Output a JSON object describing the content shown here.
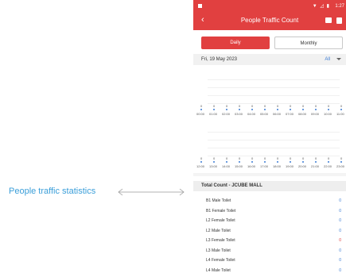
{
  "annotation": {
    "label": "People traffic statistics"
  },
  "status_bar": {
    "time": "1:27",
    "icons": "▼ ◿ ▮"
  },
  "app_bar": {
    "back": "‹",
    "title": "People Traffic Count"
  },
  "tabs": {
    "daily": "Daily",
    "monthly": "Monthly"
  },
  "date_row": {
    "date": "Fri, 19 May 2023",
    "filter": "All"
  },
  "chart_data": [
    {
      "type": "line",
      "x": [
        "0:00",
        "1:00",
        "2:00",
        "3:00",
        "4:00",
        "5:00",
        "6:00",
        "7:00",
        "8:00",
        "9:00",
        "10:00",
        "11:00"
      ],
      "values": [
        0,
        0,
        0,
        0,
        0,
        0,
        0,
        0,
        0,
        0,
        0,
        0
      ],
      "tick_labels": [
        "00:00",
        "01:00",
        "02:00",
        "03:00",
        "04:00",
        "05:00",
        "06:00",
        "07:00",
        "08:00",
        "09:00",
        "10:00",
        "11:00"
      ],
      "grid": true
    },
    {
      "type": "line",
      "x": [
        "12:00",
        "13:00",
        "14:00",
        "15:00",
        "16:00",
        "17:00",
        "18:00",
        "19:00",
        "20:00",
        "21:00",
        "22:00",
        "23:00"
      ],
      "values": [
        0,
        0,
        0,
        0,
        0,
        0,
        0,
        0,
        0,
        0,
        0,
        0
      ],
      "tick_labels": [
        "12:00",
        "13:00",
        "14:00",
        "15:00",
        "16:00",
        "17:00",
        "18:00",
        "19:00",
        "20:00",
        "21:00",
        "22:00",
        "23:00"
      ],
      "grid": true
    }
  ],
  "total_count": {
    "title": "Total Count - JCUBE MALL"
  },
  "list": [
    {
      "name": "B1 Male Toilet",
      "count": "0",
      "color": "#3a7bd5"
    },
    {
      "name": "B1 Female Toilet",
      "count": "0",
      "color": "#3a7bd5"
    },
    {
      "name": "L2 Female Toilet",
      "count": "0",
      "color": "#3a7bd5"
    },
    {
      "name": "L2 Male Toilet",
      "count": "0",
      "color": "#3a7bd5"
    },
    {
      "name": "L3 Female Toilet",
      "count": "0",
      "color": "#e14040"
    },
    {
      "name": "L3 Male Toilet",
      "count": "0",
      "color": "#3a7bd5"
    },
    {
      "name": "L4 Female Toilet",
      "count": "0",
      "color": "#3a7bd5"
    },
    {
      "name": "L4 Male Toilet",
      "count": "0",
      "color": "#3a7bd5"
    }
  ],
  "colors": {
    "brand": "#e14040",
    "accent": "#3a7bd5",
    "annotation": "#3a9ed9"
  }
}
